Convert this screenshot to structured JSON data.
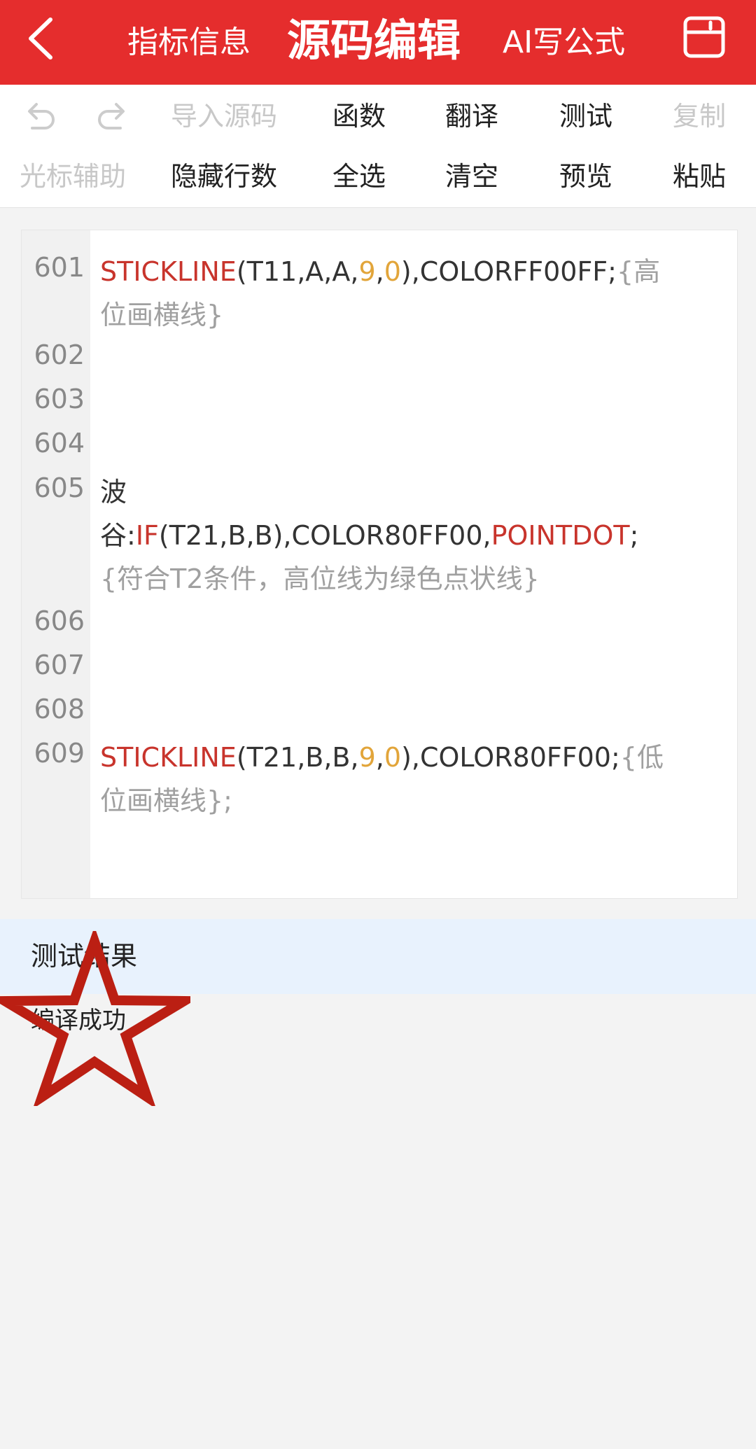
{
  "header": {
    "tab_left": "指标信息",
    "title": "源码编辑",
    "tab_right": "AI写公式",
    "back_icon": "chevron-left-icon",
    "save_icon": "save-icon",
    "bg_color": "#e52d2d"
  },
  "toolbar": {
    "row1": {
      "undo_icon": "undo-icon",
      "redo_icon": "redo-icon",
      "import": "导入源码",
      "functions": "函数",
      "translate": "翻译",
      "test": "测试",
      "copy": "复制"
    },
    "row2": {
      "cursor_assist": "光标辅助",
      "hide_lines": "隐藏行数",
      "select_all": "全选",
      "clear": "清空",
      "preview": "预览",
      "paste": "粘贴"
    }
  },
  "editor": {
    "line_numbers": [
      "601",
      "602",
      "603",
      "604",
      "605",
      "606",
      "607",
      "608",
      "609"
    ],
    "lines": {
      "l601": {
        "kw": "STICKLINE",
        "args": "(T11,A,A,",
        "n1": "9",
        "comma": ",",
        "n2": "0",
        "rest": "),COLORFF00FF;",
        "comment1": "{高",
        "comment2": "位画横线}"
      },
      "l605": {
        "name": "波",
        "name2": "谷",
        "colon": ":",
        "kw": "IF",
        "args": "(T21,B,B),COLOR80FF00,",
        "kw2": "POINTDOT",
        "semi": ";",
        "comment": "{符合T2条件，高位线为绿色点状线}"
      },
      "l609": {
        "kw": "STICKLINE",
        "args": "(T21,B,B,",
        "n1": "9",
        "comma": ",",
        "n2": "0",
        "rest": "),COLOR80FF00;",
        "comment1": "{低",
        "comment2": "位画横线};"
      }
    },
    "colors": {
      "keyword": "#c8342c",
      "number": "#e2a53a",
      "comment": "#a0a0a0"
    }
  },
  "result": {
    "title": "测试结果",
    "message": "编译成功",
    "annotation_icon": "star-icon",
    "annotation_color": "#bb1f13"
  }
}
